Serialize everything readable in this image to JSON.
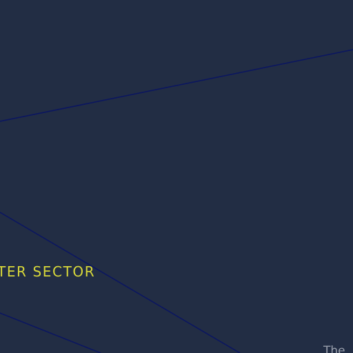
{
  "map": {
    "background_color": "#222d44",
    "road_color": "#0b1660",
    "labels": {
      "sector": {
        "text": "TER SECTOR",
        "color": "#d8d83a"
      },
      "partial_place": {
        "text": "The",
        "color": "#9aa0ad"
      }
    }
  }
}
